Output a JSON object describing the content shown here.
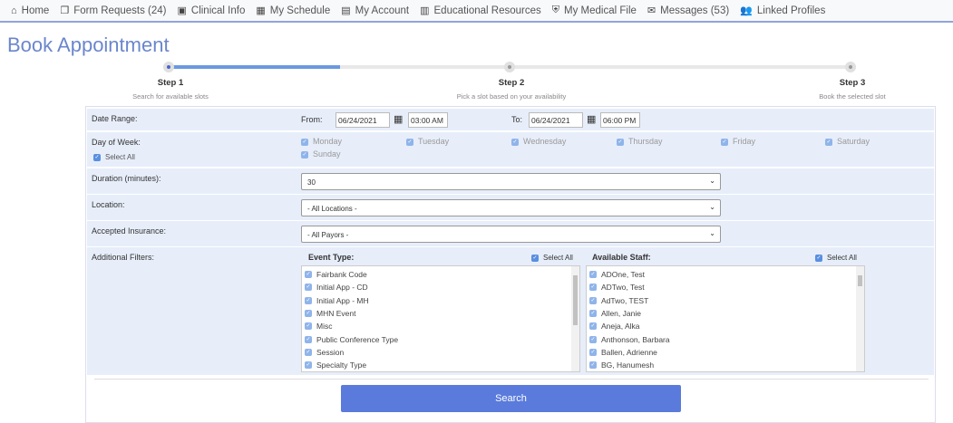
{
  "nav": [
    {
      "icon": "home-icon",
      "glyph": "⌂",
      "label": "Home"
    },
    {
      "icon": "copy-icon",
      "glyph": "❐",
      "label": "Form Requests (24)"
    },
    {
      "icon": "id-card-icon",
      "glyph": "▣",
      "label": "Clinical Info"
    },
    {
      "icon": "calendar-icon",
      "glyph": "▦",
      "label": "My Schedule"
    },
    {
      "icon": "account-icon",
      "glyph": "▤",
      "label": "My Account"
    },
    {
      "icon": "book-icon",
      "glyph": "▥",
      "label": "Educational Resources"
    },
    {
      "icon": "shield-icon",
      "glyph": "⛨",
      "label": "My Medical File"
    },
    {
      "icon": "envelope-icon",
      "glyph": "✉",
      "label": "Messages (53)"
    },
    {
      "icon": "user-plus-icon",
      "glyph": "👥",
      "label": "Linked Profiles"
    }
  ],
  "title": "Book Appointment",
  "steps": [
    {
      "title": "Step 1",
      "sub": "Search for available slots",
      "active": true
    },
    {
      "title": "Step 2",
      "sub": "Pick a slot based on your availability",
      "active": false
    },
    {
      "title": "Step 3",
      "sub": "Book the selected slot",
      "active": false
    }
  ],
  "progress_percent": 25,
  "form": {
    "date_range": {
      "label": "Date Range:",
      "from_label": "From:",
      "from_date": "06/24/2021",
      "from_time": "03:00 AM",
      "to_label": "To:",
      "to_date": "06/24/2021",
      "to_time": "06:00 PM"
    },
    "days": {
      "label": "Day of Week:",
      "select_all": "Select All",
      "items": [
        "Monday",
        "Tuesday",
        "Wednesday",
        "Thursday",
        "Friday",
        "Saturday",
        "Sunday"
      ]
    },
    "duration": {
      "label": "Duration (minutes):",
      "value": "30"
    },
    "location": {
      "label": "Location:",
      "value": "- All Locations -"
    },
    "insurance": {
      "label": "Accepted Insurance:",
      "value": "- All Payors -"
    },
    "filters": {
      "label": "Additional Filters:",
      "event_type": {
        "label": "Event Type:",
        "select_all": "Select All",
        "items": [
          "Fairbank Code",
          "Initial App - CD",
          "Initial App - MH",
          "MHN Event",
          "Misc",
          "Public Conference Type",
          "Session",
          "Specialty Type"
        ]
      },
      "staff": {
        "label": "Available Staff:",
        "select_all": "Select All",
        "items": [
          "ADOne, Test",
          "ADTwo, Test",
          "AdTwo, TEST",
          "Allen, Janie",
          "Aneja, Alka",
          "Anthonson, Barbara",
          "Ballen, Adrienne",
          "BG, Hanumesh"
        ]
      }
    }
  },
  "search_label": "Search"
}
